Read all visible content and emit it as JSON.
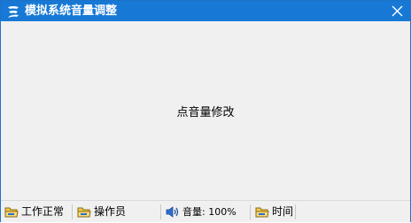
{
  "window": {
    "title": "模拟系统音量调整",
    "icon": "stylized-s-app-icon",
    "close_icon": "close-icon"
  },
  "main": {
    "label": "点音量修改"
  },
  "statusbar": {
    "items": [
      {
        "icon": "folder-icon",
        "label": "工作正常"
      },
      {
        "icon": "folder-icon",
        "label": "操作员"
      },
      {
        "icon": "speaker-icon",
        "label": "音量: 100%"
      },
      {
        "icon": "folder-icon",
        "label": "时间"
      }
    ]
  },
  "colors": {
    "titlebar": "#1779d5",
    "background": "#f0f0f0",
    "folder": "#f2c94c"
  }
}
